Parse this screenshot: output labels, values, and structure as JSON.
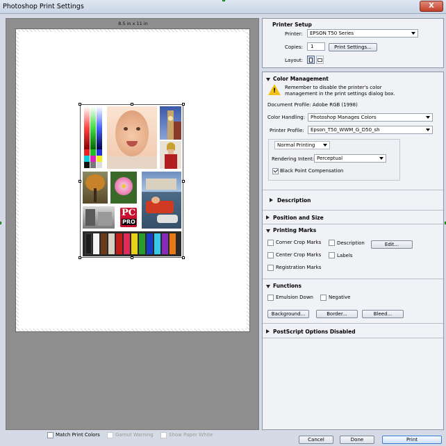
{
  "window": {
    "title": "Photoshop Print Settings",
    "close_label": "X"
  },
  "preview": {
    "page_size": "8.5 in x 11 in"
  },
  "printer_setup": {
    "heading": "Printer Setup",
    "printer_label": "Printer:",
    "printer_value": "EPSON T50 Series",
    "copies_label": "Copies:",
    "copies_value": "1",
    "print_settings_button": "Print Settings...",
    "layout_label": "Layout:"
  },
  "color_management": {
    "heading": "Color Management",
    "warning_line1": "Remember to disable the printer's color",
    "warning_line2": "management in the print settings dialog box.",
    "document_profile": "Document Profile: Adobe RGB (1998)",
    "color_handling_label": "Color Handling:",
    "color_handling_value": "Photoshop Manages Colors",
    "printer_profile_label": "Printer Profile:",
    "printer_profile_value": "Epson_T50_WWM_G_D50_sh",
    "print_mode_value": "Normal Printing",
    "rendering_intent_label": "Rendering Intent:",
    "rendering_intent_value": "Perceptual",
    "black_point_label": "Black Point Compensation",
    "description_heading": "Description"
  },
  "position_size": {
    "heading": "Position and Size"
  },
  "printing_marks": {
    "heading": "Printing Marks",
    "corner_crop": "Corner Crop Marks",
    "center_crop": "Center Crop Marks",
    "registration": "Registration Marks",
    "description": "Description",
    "labels": "Labels",
    "edit_button": "Edit..."
  },
  "functions": {
    "heading": "Functions",
    "emulsion_down": "Emulsion Down",
    "negative": "Negative",
    "background_button": "Background...",
    "border_button": "Border...",
    "bleed_button": "Bleed..."
  },
  "postscript": {
    "heading": "PostScript Options Disabled"
  },
  "bottom": {
    "match_print_colors": "Match Print Colors",
    "gamut_warning": "Gamut Warning",
    "show_paper_white": "Show Paper White",
    "cancel": "Cancel",
    "done": "Done",
    "print": "Print"
  },
  "colors": {
    "accent": "#4a78c2",
    "preview_bg": "#8e8e8e",
    "dialog_bg": "#d4dbe6"
  }
}
